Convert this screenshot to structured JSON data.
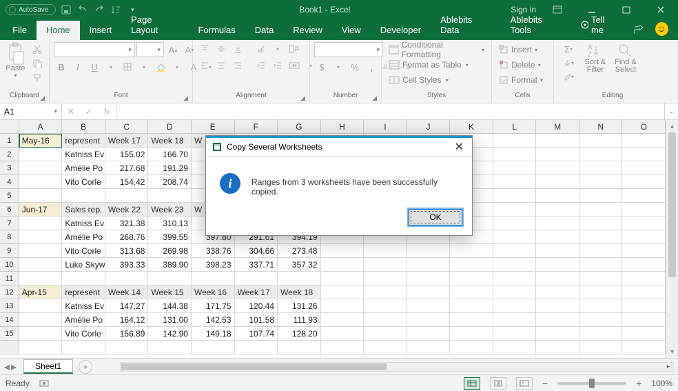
{
  "titlebar": {
    "autosave_label": "AutoSave",
    "doc_title": "Book1 - Excel",
    "sign_in": "Sign in"
  },
  "menu": {
    "file": "File",
    "home": "Home",
    "insert": "Insert",
    "page_layout": "Page Layout",
    "formulas": "Formulas",
    "data": "Data",
    "review": "Review",
    "view": "View",
    "developer": "Developer",
    "ablebits_data": "Ablebits Data",
    "ablebits_tools": "Ablebits Tools",
    "tell_me": "Tell me"
  },
  "ribbon": {
    "clipboard": {
      "label": "Clipboard",
      "paste": "Paste"
    },
    "font": {
      "label": "Font",
      "name": "",
      "size": ""
    },
    "alignment": {
      "label": "Alignment"
    },
    "number": {
      "label": "Number",
      "format": ""
    },
    "styles": {
      "label": "Styles",
      "cond_fmt": "Conditional Formatting",
      "fmt_table": "Format as Table",
      "cell_styles": "Cell Styles"
    },
    "cells": {
      "label": "Cells",
      "insert": "Insert",
      "delete": "Delete",
      "format": "Format"
    },
    "editing": {
      "label": "Editing",
      "sort": "Sort & Filter",
      "find": "Find & Select"
    }
  },
  "formula_bar": {
    "name_box": "A1",
    "formula": ""
  },
  "columns": [
    "A",
    "B",
    "C",
    "D",
    "E",
    "F",
    "G",
    "H",
    "I",
    "J",
    "K",
    "L",
    "M",
    "N",
    "O"
  ],
  "rows": [
    {
      "n": 1,
      "type": "section",
      "cells": [
        "May-16",
        "represent",
        "Week 17",
        "Week 18",
        "W"
      ]
    },
    {
      "n": 2,
      "type": "data",
      "cells": [
        "",
        "Katniss Ev",
        "155.02",
        "166.70",
        ""
      ]
    },
    {
      "n": 3,
      "type": "data",
      "cells": [
        "",
        "Amélie Po",
        "217.68",
        "191.29",
        ""
      ]
    },
    {
      "n": 4,
      "type": "data",
      "cells": [
        "",
        "Vito Corle",
        "154.42",
        "208.74",
        ""
      ]
    },
    {
      "n": 5,
      "type": "empty",
      "cells": [
        "",
        "",
        "",
        "",
        "",
        "",
        "",
        ""
      ]
    },
    {
      "n": 6,
      "type": "section",
      "cells": [
        "Jun-17",
        "Sales rep.",
        "Week 22",
        "Week 23",
        "W"
      ]
    },
    {
      "n": 7,
      "type": "data",
      "cells": [
        "",
        "Katniss Ev",
        "321.38",
        "310.13",
        ""
      ]
    },
    {
      "n": 8,
      "type": "data",
      "cells": [
        "",
        "Amélie Po",
        "268.76",
        "399.55",
        "397.80",
        "291.61",
        "394.19"
      ]
    },
    {
      "n": 9,
      "type": "data",
      "cells": [
        "",
        "Vito Corle",
        "313.68",
        "269.98",
        "338.76",
        "304.66",
        "273.48"
      ]
    },
    {
      "n": 10,
      "type": "data",
      "cells": [
        "",
        "Luke Skyw",
        "393.33",
        "389.90",
        "398.23",
        "337.71",
        "357.32"
      ]
    },
    {
      "n": 11,
      "type": "empty",
      "cells": [
        "",
        "",
        "",
        "",
        "",
        "",
        "",
        ""
      ]
    },
    {
      "n": 12,
      "type": "section",
      "cells": [
        "Apr-15",
        "represent",
        "Week 14",
        "Week 15",
        "Week 16",
        "Week 17",
        "Week 18"
      ]
    },
    {
      "n": 13,
      "type": "data",
      "cells": [
        "",
        "Katniss Ev",
        "147.27",
        "144.38",
        "171.75",
        "120.44",
        "131.26"
      ]
    },
    {
      "n": 14,
      "type": "data",
      "cells": [
        "",
        "Amélie Po",
        "164.12",
        "131.00",
        "142.53",
        "101.58",
        "111.93"
      ]
    },
    {
      "n": 15,
      "type": "data",
      "cells": [
        "",
        "Vito Corle",
        "156.89",
        "142.90",
        "149.18",
        "107.74",
        "128.20"
      ]
    }
  ],
  "sheet": {
    "active": "Sheet1"
  },
  "status": {
    "ready": "Ready",
    "zoom": "100%"
  },
  "dialog": {
    "title": "Copy Several Worksheets",
    "message": "Ranges from 3 worksheets have been successfully copied.",
    "ok": "OK"
  },
  "chart_data": null
}
